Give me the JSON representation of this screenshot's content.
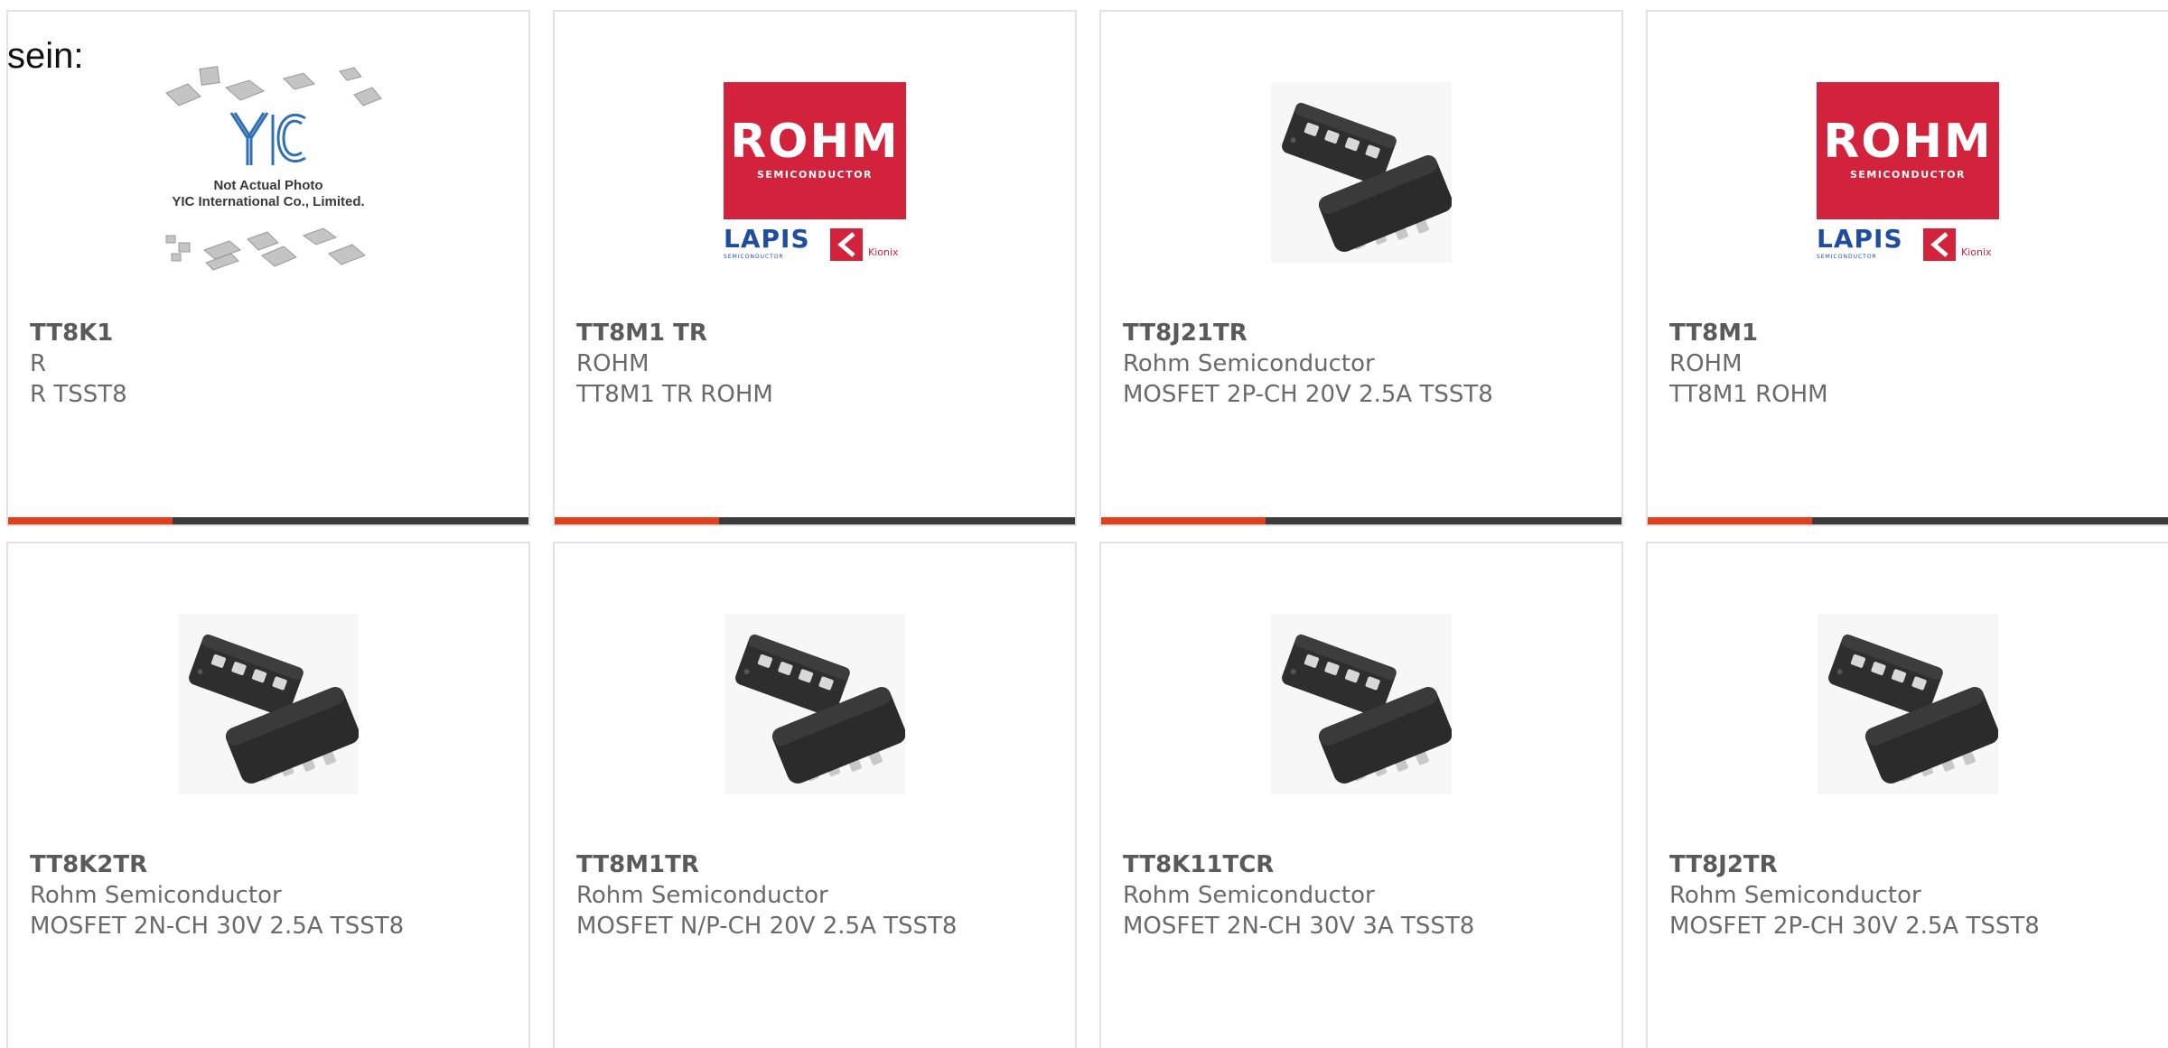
{
  "intro_text": "sein:",
  "placeholder": {
    "line1": "Not Actual Photo",
    "line2": "YIC International Co., Limited.",
    "mark": "YIC"
  },
  "rohm_logo": {
    "brand": "ROHM",
    "sub": "SEMICONDUCTOR",
    "lapis": "LAPIS",
    "lapis_sub": "SEMICONDUCTOR",
    "kionix": "Kionix"
  },
  "colors": {
    "accent": "#e2401c",
    "bar": "#3b3b3b",
    "rohm_red": "#d3223b",
    "lapis_blue": "#1f4ea1",
    "card_border": "#e2e2e2",
    "text": "#6a6a6a"
  },
  "products": [
    {
      "part": "TT8K1",
      "manufacturer": "R",
      "description": "R TSST8",
      "image": "yic-placeholder"
    },
    {
      "part": "TT8M1 TR",
      "manufacturer": "ROHM",
      "description": "TT8M1 TR ROHM",
      "image": "rohm-logo"
    },
    {
      "part": "TT8J21TR",
      "manufacturer": "Rohm Semiconductor",
      "description": "MOSFET 2P-CH 20V 2.5A TSST8",
      "image": "tsst8-package"
    },
    {
      "part": "TT8M1",
      "manufacturer": "ROHM",
      "description": "TT8M1 ROHM",
      "image": "rohm-logo"
    },
    {
      "part": "TT8K2TR",
      "manufacturer": "Rohm Semiconductor",
      "description": "MOSFET 2N-CH 30V 2.5A TSST8",
      "image": "tsst8-package"
    },
    {
      "part": "TT8M1TR",
      "manufacturer": "Rohm Semiconductor",
      "description": "MOSFET N/P-CH 20V 2.5A TSST8",
      "image": "tsst8-package"
    },
    {
      "part": "TT8K11TCR",
      "manufacturer": "Rohm Semiconductor",
      "description": "MOSFET 2N-CH 30V 3A TSST8",
      "image": "tsst8-package"
    },
    {
      "part": "TT8J2TR",
      "manufacturer": "Rohm Semiconductor",
      "description": "MOSFET 2P-CH 30V 2.5A TSST8",
      "image": "tsst8-package"
    }
  ]
}
